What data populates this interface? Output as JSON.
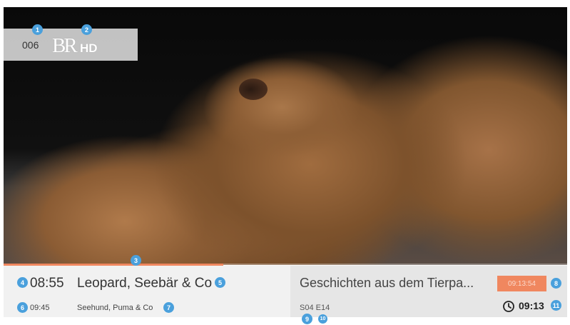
{
  "channel": {
    "number": "006",
    "logo_text": "BR",
    "logo_suffix": "HD"
  },
  "current_program": {
    "start_time": "08:55",
    "title": "Leopard, Seebär & Co",
    "progress_fraction": 0.39
  },
  "next_program": {
    "start_time": "09:45",
    "title": "Seehund, Puma & Co"
  },
  "episode": {
    "title": "Geschichten aus dem Tierpa...",
    "season_episode": "S04 E14"
  },
  "timer_badge": {
    "text": "09:13:54",
    "color": "#f0875f"
  },
  "clock": {
    "icon": "clock-icon",
    "time": "09:13"
  },
  "markers": [
    "1",
    "2",
    "3",
    "4",
    "5",
    "6",
    "7",
    "8",
    "9",
    "10",
    "11"
  ],
  "colors": {
    "accent": "#f0875f",
    "marker": "#4aa0dc"
  }
}
